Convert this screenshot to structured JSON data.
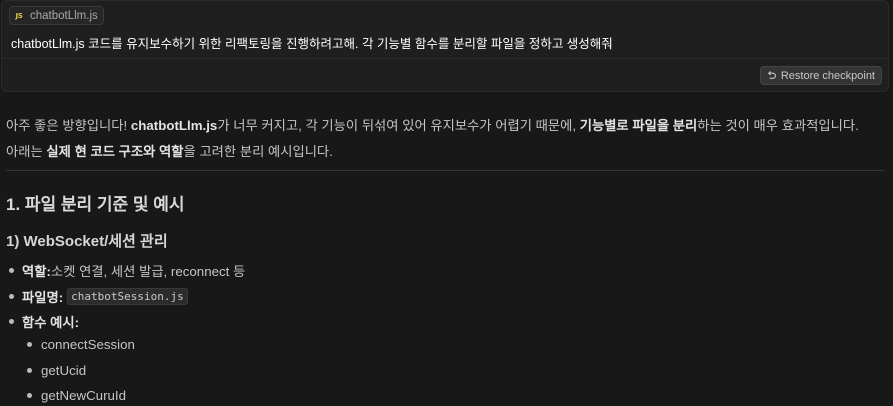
{
  "prompt": {
    "file_chip": {
      "icon": "js-file-icon",
      "icon_text": "JS",
      "label": "chatbotLlm.js"
    },
    "message": "chatbotLlm.js 코드를 유지보수하기 위한 리팩토링을 진행하려고해. 각 기능별 함수를 분리할 파일을 정하고 생성해줘",
    "restore_button": {
      "icon": "restore-icon",
      "label": "Restore checkpoint"
    }
  },
  "response": {
    "intro": {
      "p1_pre": "아주 좋은 방향입니다! ",
      "p1_bold1": "chatbotLlm.js",
      "p1_mid": "가 너무 커지고, 각 기능이 뒤섞여 있어 유지보수가 어렵기 때문에, ",
      "p1_bold2": "기능별로 파일을 분리",
      "p1_post": "하는 것이 매우 효과적입니다.",
      "p2_pre": "아래는 ",
      "p2_bold": "실제 현 코드 구조와 역할",
      "p2_post": "을 고려한 분리 예시입니다."
    },
    "heading1": "1. 파일 분리 기준 및 예시",
    "heading2": "1) WebSocket/세션 관리",
    "bullets": {
      "role_label": "역할:",
      "role_text": " 소켓 연결, 세션 발급, reconnect 등",
      "filename_label": "파일명:",
      "filename_code": "chatbotSession.js",
      "functions_label": "함수 예시:"
    },
    "functions": [
      "connectSession",
      "getUcid",
      "getNewCuruId"
    ]
  }
}
